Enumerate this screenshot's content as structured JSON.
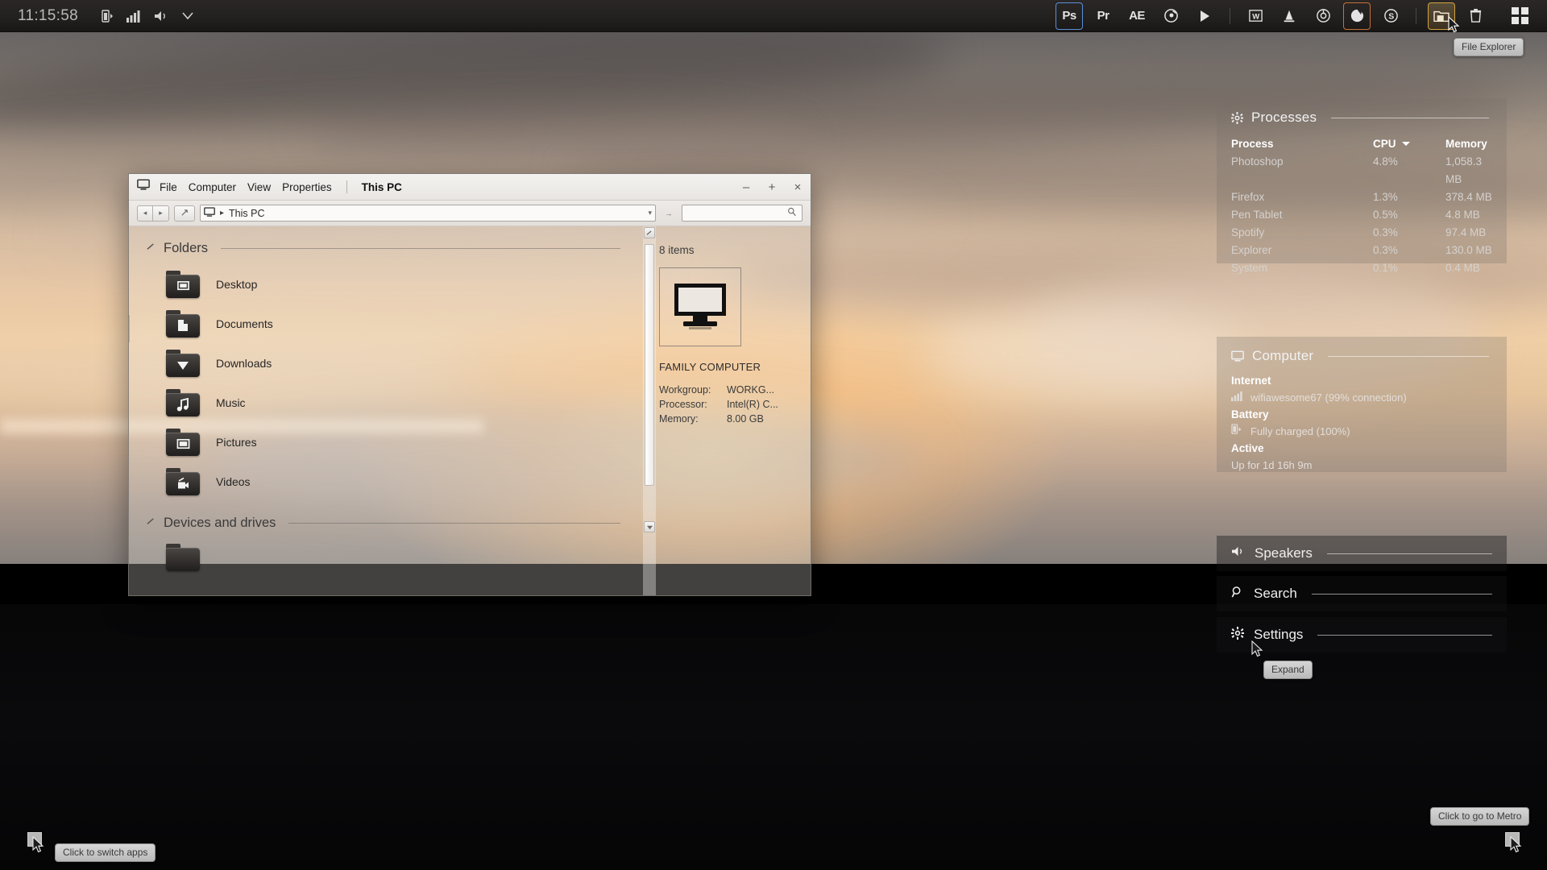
{
  "taskbar": {
    "clock": "11:15:58",
    "left_icons": [
      "battery-icon",
      "signal-icon",
      "volume-icon",
      "chevron-down-icon"
    ],
    "apps": [
      {
        "name": "photoshop",
        "label": "Ps",
        "selected": "blue"
      },
      {
        "name": "premiere",
        "label": "Pr",
        "selected": "none"
      },
      {
        "name": "after-effects",
        "label": "AE",
        "selected": "none"
      },
      {
        "name": "spotify",
        "label": "spotify-icon",
        "selected": "none"
      },
      {
        "name": "media-player",
        "label": "play-icon",
        "selected": "none"
      },
      {
        "name": "word",
        "label": "W",
        "selected": "none"
      },
      {
        "name": "pen-tablet",
        "label": "tablet-icon",
        "selected": "none"
      },
      {
        "name": "chrome",
        "label": "chrome-icon",
        "selected": "none"
      },
      {
        "name": "firefox",
        "label": "firefox-icon",
        "selected": "orange"
      },
      {
        "name": "skype",
        "label": "S",
        "selected": "none"
      },
      {
        "name": "file-explorer",
        "label": "folder-icon",
        "selected": "gold"
      },
      {
        "name": "recycle-bin",
        "label": "trash-icon",
        "selected": "none"
      }
    ],
    "start_label": "windows-logo-icon",
    "tooltip": "File Explorer"
  },
  "processes_widget": {
    "title": "Processes",
    "icon": "gear-icon",
    "columns": [
      "Process",
      "CPU",
      "Memory"
    ],
    "sorted_by": "CPU",
    "rows": [
      {
        "process": "Photoshop",
        "cpu": "4.8%",
        "memory": "1,058.3 MB"
      },
      {
        "process": "Firefox",
        "cpu": "1.3%",
        "memory": "378.4 MB"
      },
      {
        "process": "Pen Tablet",
        "cpu": "0.5%",
        "memory": "4.8 MB"
      },
      {
        "process": "Spotify",
        "cpu": "0.3%",
        "memory": "97.4 MB"
      },
      {
        "process": "Explorer",
        "cpu": "0.3%",
        "memory": "130.0 MB"
      },
      {
        "process": "System",
        "cpu": "0.1%",
        "memory": "0.4 MB"
      }
    ]
  },
  "computer_widget": {
    "title": "Computer",
    "icon": "monitor-icon",
    "internet_label": "Internet",
    "internet_value": "wifiawesome67 (99% connection)",
    "internet_icon": "signal-icon",
    "battery_label": "Battery",
    "battery_value": "Fully charged (100%)",
    "battery_icon": "battery-charging-icon",
    "active_label": "Active",
    "active_value": "Up for 1d 16h 9m"
  },
  "strips": [
    {
      "name": "speakers",
      "label": "Speakers",
      "icon": "speaker-icon"
    },
    {
      "name": "search",
      "label": "Search",
      "icon": "magnifier-icon"
    },
    {
      "name": "settings",
      "label": "Settings",
      "icon": "gear-icon"
    }
  ],
  "explorer": {
    "window_icon": "monitor-icon",
    "menu": [
      "File",
      "Computer",
      "View",
      "Properties"
    ],
    "location": "This PC",
    "window_buttons": {
      "minimize": "–",
      "maximize": "+",
      "close": "×"
    },
    "nav": {
      "back": "◂",
      "forward": "▸",
      "up": "⬈",
      "address_icon": "monitor-icon",
      "address_separator": "▸",
      "address_text": "This PC",
      "address_caret": "▾",
      "go": "→",
      "search_placeholder": "",
      "search_icon": "magnifier-icon"
    },
    "sections": [
      {
        "name": "folders",
        "title": "Folders"
      },
      {
        "name": "devices-and-drives",
        "title": "Devices and drives"
      }
    ],
    "folders": [
      {
        "label": "Desktop",
        "icon": "desktop-folder-icon"
      },
      {
        "label": "Documents",
        "icon": "documents-folder-icon"
      },
      {
        "label": "Downloads",
        "icon": "downloads-folder-icon"
      },
      {
        "label": "Music",
        "icon": "music-folder-icon"
      },
      {
        "label": "Pictures",
        "icon": "pictures-folder-icon"
      },
      {
        "label": "Videos",
        "icon": "videos-folder-icon"
      }
    ],
    "details": {
      "item_count": "8 items",
      "preview_icon": "computer-monitor-icon",
      "name": "FAMILY COMPUTER",
      "properties": [
        {
          "key": "Workgroup:",
          "value": "WORKG..."
        },
        {
          "key": "Processor:",
          "value": "Intel(R) C..."
        },
        {
          "key": "Memory:",
          "value": "8.00 GB"
        }
      ]
    },
    "edge_handle": "»"
  },
  "tooltips": {
    "switch_apps": "Click to switch apps",
    "go_to_metro": "Click to go to Metro",
    "expand": "Expand"
  },
  "colors": {
    "accent_blue": "#5b8fd6",
    "accent_orange": "#c5713a",
    "accent_gold": "#d3a23c",
    "taskbar_bg": "#232020",
    "widget_text": "#ffffff"
  }
}
